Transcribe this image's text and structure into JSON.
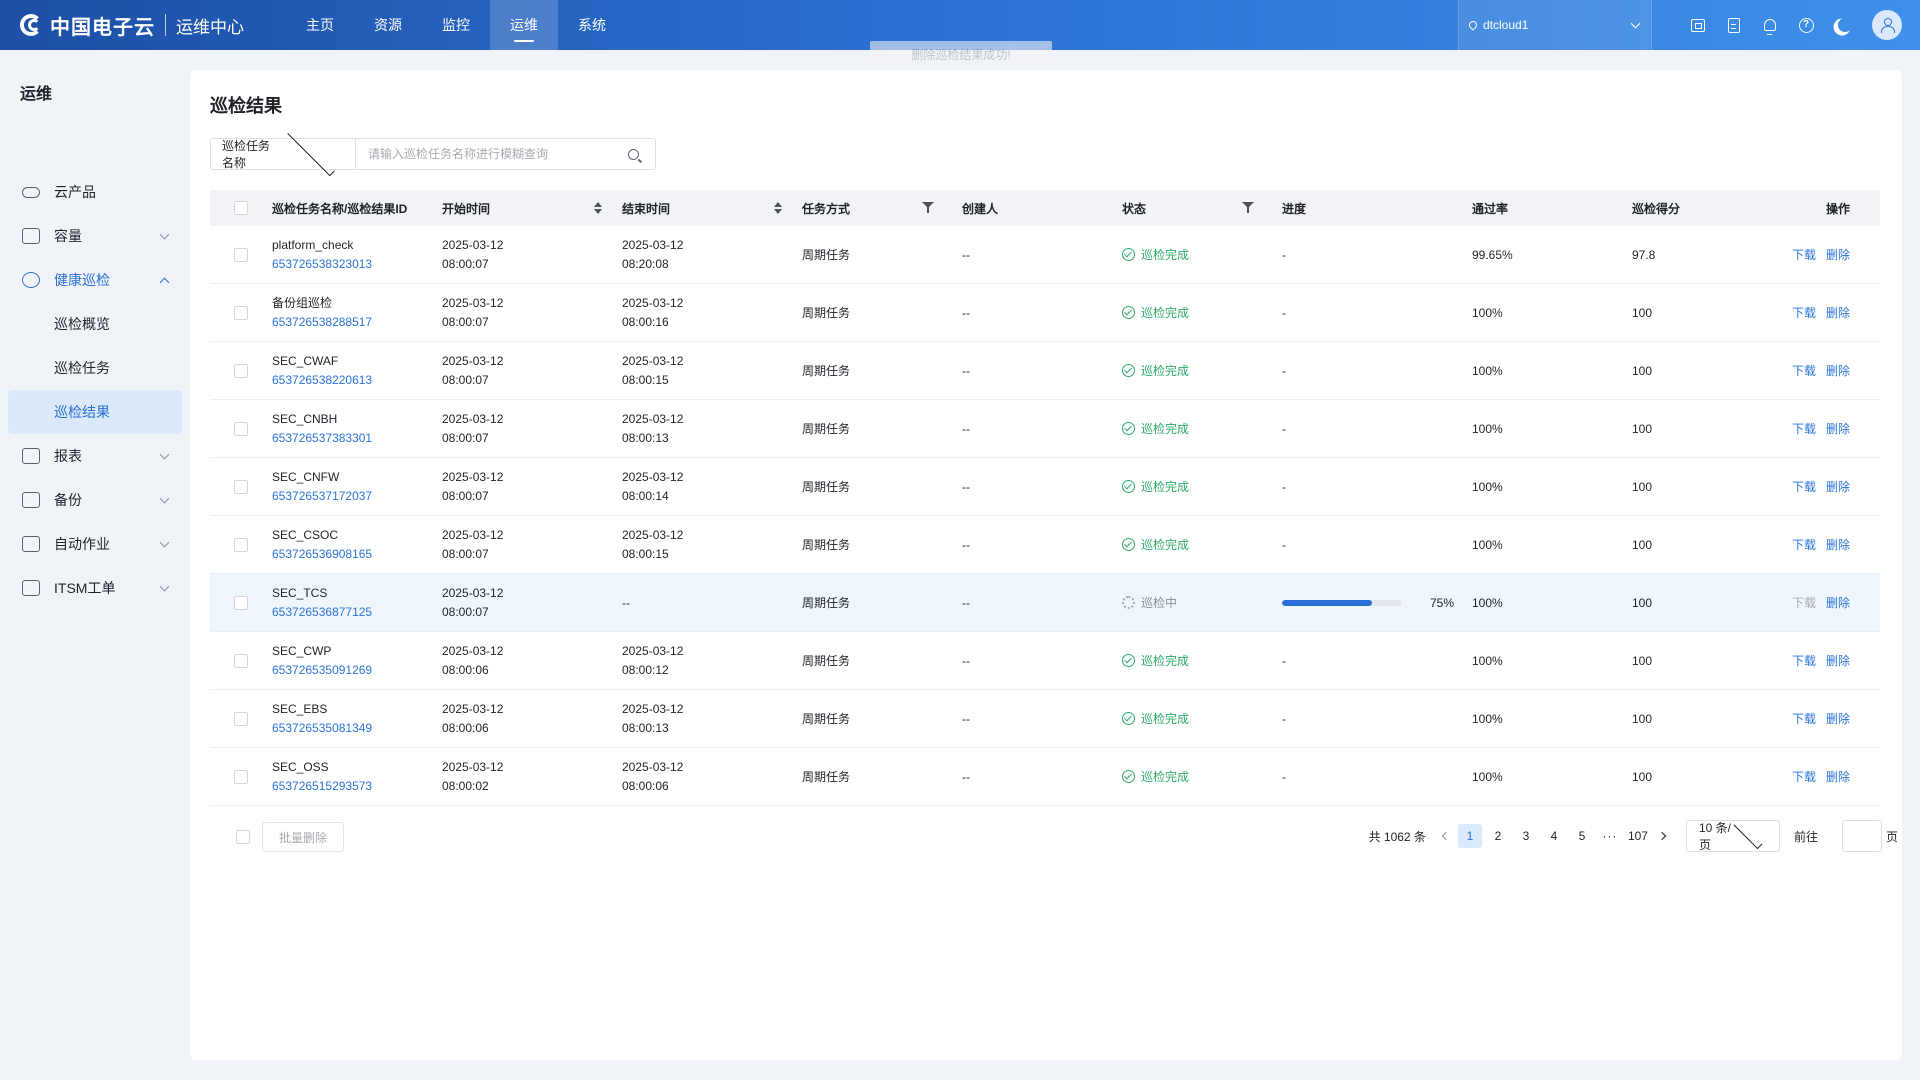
{
  "app": {
    "brand_name": "中国电子云",
    "brand_sub": "运维中心"
  },
  "nav": {
    "items": [
      {
        "label": "主页"
      },
      {
        "label": "资源"
      },
      {
        "label": "监控"
      },
      {
        "label": "运维",
        "active": true
      },
      {
        "label": "系统"
      }
    ]
  },
  "region": {
    "value": "dtcloud1"
  },
  "toolbar_icons": [
    "screen-icon",
    "document-icon",
    "bell-icon",
    "help-icon",
    "moon-icon",
    "user-avatar-icon"
  ],
  "toast": {
    "message": "删除巡检结果成功!"
  },
  "sidebar": {
    "title": "运维",
    "items": [
      {
        "label": "云产品",
        "icon": "cloud-icon"
      },
      {
        "label": "容量",
        "icon": "capacity-icon"
      },
      {
        "label": "健康巡检",
        "icon": "health-check-icon",
        "open": true,
        "children": [
          {
            "label": "巡检概览"
          },
          {
            "label": "巡检任务"
          },
          {
            "label": "巡检结果",
            "active": true
          }
        ]
      },
      {
        "label": "报表",
        "icon": "report-icon"
      },
      {
        "label": "备份",
        "icon": "backup-icon"
      },
      {
        "label": "自动作业",
        "icon": "automation-icon"
      },
      {
        "label": "ITSM工单",
        "icon": "ticket-icon"
      }
    ]
  },
  "page": {
    "title": "巡检结果",
    "search": {
      "field": "巡检任务名称",
      "placeholder": "请输入巡检任务名称进行模糊查询",
      "value": ""
    }
  },
  "table": {
    "headers": {
      "name": "巡检任务名称/巡检结果ID",
      "start": "开始时间",
      "end": "结束时间",
      "mode": "任务方式",
      "creator": "创建人",
      "status": "状态",
      "progress": "进度",
      "pass_rate": "通过率",
      "score": "巡检得分",
      "ops": "操作"
    },
    "actions": {
      "download": "下载",
      "delete": "删除"
    },
    "rows": [
      {
        "name": "platform_check",
        "id": "653726538323013",
        "start_date": "2025-03-12",
        "start_time": "08:00:07",
        "end_date": "2025-03-12",
        "end_time": "08:20:08",
        "mode": "周期任务",
        "creator": "--",
        "status": "巡检完成",
        "progress": "-",
        "pass_rate": "99.65%",
        "score": "97.8"
      },
      {
        "name": "备份组巡检",
        "id": "653726538288517",
        "start_date": "2025-03-12",
        "start_time": "08:00:07",
        "end_date": "2025-03-12",
        "end_time": "08:00:16",
        "mode": "周期任务",
        "creator": "--",
        "status": "巡检完成",
        "progress": "-",
        "pass_rate": "100%",
        "score": "100"
      },
      {
        "name": "SEC_CWAF",
        "id": "653726538220613",
        "start_date": "2025-03-12",
        "start_time": "08:00:07",
        "end_date": "2025-03-12",
        "end_time": "08:00:15",
        "mode": "周期任务",
        "creator": "--",
        "status": "巡检完成",
        "progress": "-",
        "pass_rate": "100%",
        "score": "100"
      },
      {
        "name": "SEC_CNBH",
        "id": "653726537383301",
        "start_date": "2025-03-12",
        "start_time": "08:00:07",
        "end_date": "2025-03-12",
        "end_time": "08:00:13",
        "mode": "周期任务",
        "creator": "--",
        "status": "巡检完成",
        "progress": "-",
        "pass_rate": "100%",
        "score": "100"
      },
      {
        "name": "SEC_CNFW",
        "id": "653726537172037",
        "start_date": "2025-03-12",
        "start_time": "08:00:07",
        "end_date": "2025-03-12",
        "end_time": "08:00:14",
        "mode": "周期任务",
        "creator": "--",
        "status": "巡检完成",
        "progress": "-",
        "pass_rate": "100%",
        "score": "100"
      },
      {
        "name": "SEC_CSOC",
        "id": "653726536908165",
        "start_date": "2025-03-12",
        "start_time": "08:00:07",
        "end_date": "2025-03-12",
        "end_time": "08:00:15",
        "mode": "周期任务",
        "creator": "--",
        "status": "巡检完成",
        "progress": "-",
        "pass_rate": "100%",
        "score": "100"
      },
      {
        "name": "SEC_TCS",
        "id": "653726536877125",
        "start_date": "2025-03-12",
        "start_time": "08:00:07",
        "end_date": "--",
        "end_time": "",
        "mode": "周期任务",
        "creator": "--",
        "status": "巡检中",
        "running": true,
        "progress_pct": 75,
        "progress": "75%",
        "pass_rate": "100%",
        "score": "100"
      },
      {
        "name": "SEC_CWP",
        "id": "653726535091269",
        "start_date": "2025-03-12",
        "start_time": "08:00:06",
        "end_date": "2025-03-12",
        "end_time": "08:00:12",
        "mode": "周期任务",
        "creator": "--",
        "status": "巡检完成",
        "progress": "-",
        "pass_rate": "100%",
        "score": "100"
      },
      {
        "name": "SEC_EBS",
        "id": "653726535081349",
        "start_date": "2025-03-12",
        "start_time": "08:00:06",
        "end_date": "2025-03-12",
        "end_time": "08:00:13",
        "mode": "周期任务",
        "creator": "--",
        "status": "巡检完成",
        "progress": "-",
        "pass_rate": "100%",
        "score": "100"
      },
      {
        "name": "SEC_OSS",
        "id": "653726515293573",
        "start_date": "2025-03-12",
        "start_time": "08:00:02",
        "end_date": "2025-03-12",
        "end_time": "08:00:06",
        "mode": "周期任务",
        "creator": "--",
        "status": "巡检完成",
        "progress": "-",
        "pass_rate": "100%",
        "score": "100"
      }
    ]
  },
  "footer": {
    "batch_delete": "批量删除",
    "total": "共 1062 条",
    "pages": [
      "1",
      "2",
      "3",
      "4",
      "5"
    ],
    "ellipsis": "···",
    "last_page": "107",
    "current_page": "1",
    "page_size": "10 条/页",
    "goto_label": "前往",
    "goto_value": "",
    "page_unit": "页"
  },
  "colors": {
    "primary": "#2a6fd6",
    "link": "#2a74d8",
    "success": "#2bab68",
    "topbar_start": "#1d4fa5",
    "topbar_end": "#3f90ea"
  }
}
